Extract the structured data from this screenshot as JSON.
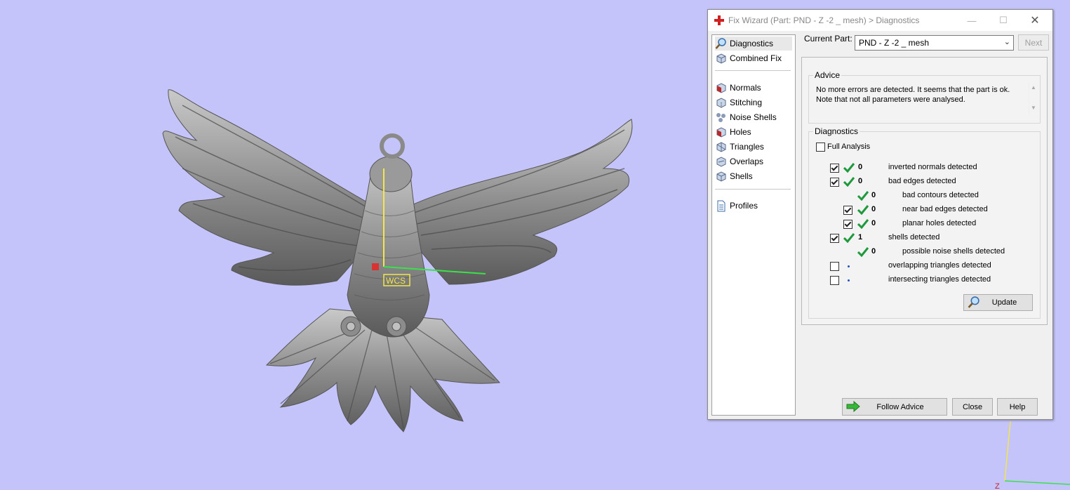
{
  "viewport": {
    "wcs_label": "WCS",
    "axis_z_label": "Z"
  },
  "dialog": {
    "title": "Fix Wizard (Part: PND - Z -2 _ mesh) > Diagnostics",
    "nav": [
      {
        "label": "Diagnostics",
        "icon": "magnifier-icon",
        "selected": true
      },
      {
        "label": "Combined Fix",
        "icon": "cube-icon"
      },
      {
        "label": "Normals",
        "icon": "normals-cube-icon"
      },
      {
        "label": "Stitching",
        "icon": "stitching-cube-icon"
      },
      {
        "label": "Noise Shells",
        "icon": "noise-shells-icon"
      },
      {
        "label": "Holes",
        "icon": "holes-cube-icon"
      },
      {
        "label": "Triangles",
        "icon": "triangles-cube-icon"
      },
      {
        "label": "Overlaps",
        "icon": "overlaps-cube-icon"
      },
      {
        "label": "Shells",
        "icon": "shells-cube-icon"
      },
      {
        "label": "Profiles",
        "icon": "document-icon"
      }
    ],
    "current_part_label": "Current Part:",
    "current_part_value": "PND - Z -2 _ mesh",
    "next_label": "Next",
    "advice": {
      "title": "Advice",
      "line1": "No more errors are detected. It seems that the part is ok.",
      "line2": "Note that not all parameters were analysed."
    },
    "diagnostics": {
      "title": "Diagnostics",
      "full_analysis_label": "Full Analysis",
      "rows": [
        {
          "checked": true,
          "status": "ok",
          "count": "0",
          "label": "inverted normals detected"
        },
        {
          "checked": true,
          "status": "ok",
          "count": "0",
          "label": "bad edges detected"
        },
        {
          "checked": null,
          "status": "ok",
          "count": "0",
          "label": "bad contours detected"
        },
        {
          "checked": true,
          "status": "ok",
          "count": "0",
          "label": "near bad edges detected"
        },
        {
          "checked": true,
          "status": "ok",
          "count": "0",
          "label": "planar holes detected"
        },
        {
          "checked": true,
          "status": "ok",
          "count": "1",
          "label": "shells detected"
        },
        {
          "checked": null,
          "status": "ok",
          "count": "0",
          "label": "possible noise shells detected"
        },
        {
          "checked": false,
          "status": "not-analysed",
          "count": "",
          "label": "overlapping triangles detected"
        },
        {
          "checked": false,
          "status": "not-analysed",
          "count": "",
          "label": "intersecting triangles detected"
        }
      ],
      "update_label": "Update"
    },
    "follow_advice_label": "Follow Advice",
    "close_label": "Close",
    "help_label": "Help"
  }
}
